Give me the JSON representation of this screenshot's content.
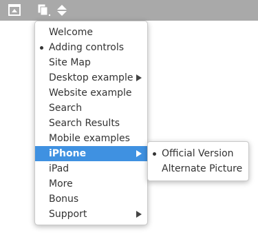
{
  "toolbar": {
    "icons": [
      "window-icon",
      "copy-dropdown-icon",
      "sort-arrows-icon"
    ]
  },
  "main_menu": {
    "items": [
      {
        "label": "Welcome",
        "checked": false,
        "submenu": false
      },
      {
        "label": "Adding controls",
        "checked": true,
        "submenu": false
      },
      {
        "label": "Site Map",
        "checked": false,
        "submenu": false
      },
      {
        "label": "Desktop example",
        "checked": false,
        "submenu": true
      },
      {
        "label": "Website example",
        "checked": false,
        "submenu": false
      },
      {
        "label": "Search",
        "checked": false,
        "submenu": false
      },
      {
        "label": "Search Results",
        "checked": false,
        "submenu": false
      },
      {
        "label": "Mobile examples",
        "checked": false,
        "submenu": false
      },
      {
        "label": "iPhone",
        "checked": false,
        "submenu": true,
        "active": true
      },
      {
        "label": "iPad",
        "checked": false,
        "submenu": false
      },
      {
        "label": "More",
        "checked": false,
        "submenu": false
      },
      {
        "label": "Bonus",
        "checked": false,
        "submenu": false
      },
      {
        "label": "Support",
        "checked": false,
        "submenu": true
      }
    ]
  },
  "sub_menu": {
    "items": [
      {
        "label": "Official Version",
        "checked": true
      },
      {
        "label": "Alternate Picture",
        "checked": false
      }
    ]
  },
  "colors": {
    "toolbar_bg": "#a9a9a9",
    "highlight": "#3f91e1"
  }
}
